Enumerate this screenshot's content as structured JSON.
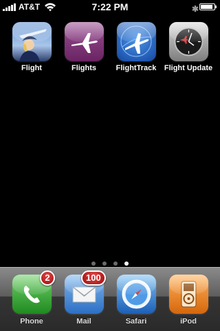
{
  "status_bar": {
    "carrier": "AT&T",
    "time": "7:22 PM",
    "icons": [
      "signal-bars-icon",
      "wifi-icon",
      "bluetooth-icon",
      "battery-icon"
    ],
    "battery_level": 0.9
  },
  "home_apps": [
    {
      "label": "Flight",
      "icon": "flight-attendant-icon"
    },
    {
      "label": "Flights",
      "icon": "airplane-purple-icon"
    },
    {
      "label": "FlightTrack",
      "icon": "airplane-globe-icon"
    },
    {
      "label": "Flight Update",
      "icon": "clock-airplane-icon"
    }
  ],
  "page_indicator": {
    "pages": 4,
    "current": 4
  },
  "dock": [
    {
      "label": "Phone",
      "icon": "phone-icon",
      "badge": "2"
    },
    {
      "label": "Mail",
      "icon": "mail-icon",
      "badge": "100"
    },
    {
      "label": "Safari",
      "icon": "compass-icon"
    },
    {
      "label": "iPod",
      "icon": "ipod-icon"
    }
  ],
  "colors": {
    "background": "#000000",
    "badge": "#c81a1a",
    "flights_icon": "#7a2f74",
    "flighttrack_icon": "#1f63c7",
    "phone_icon": "#3aa43a",
    "ipod_icon": "#e07a18"
  }
}
